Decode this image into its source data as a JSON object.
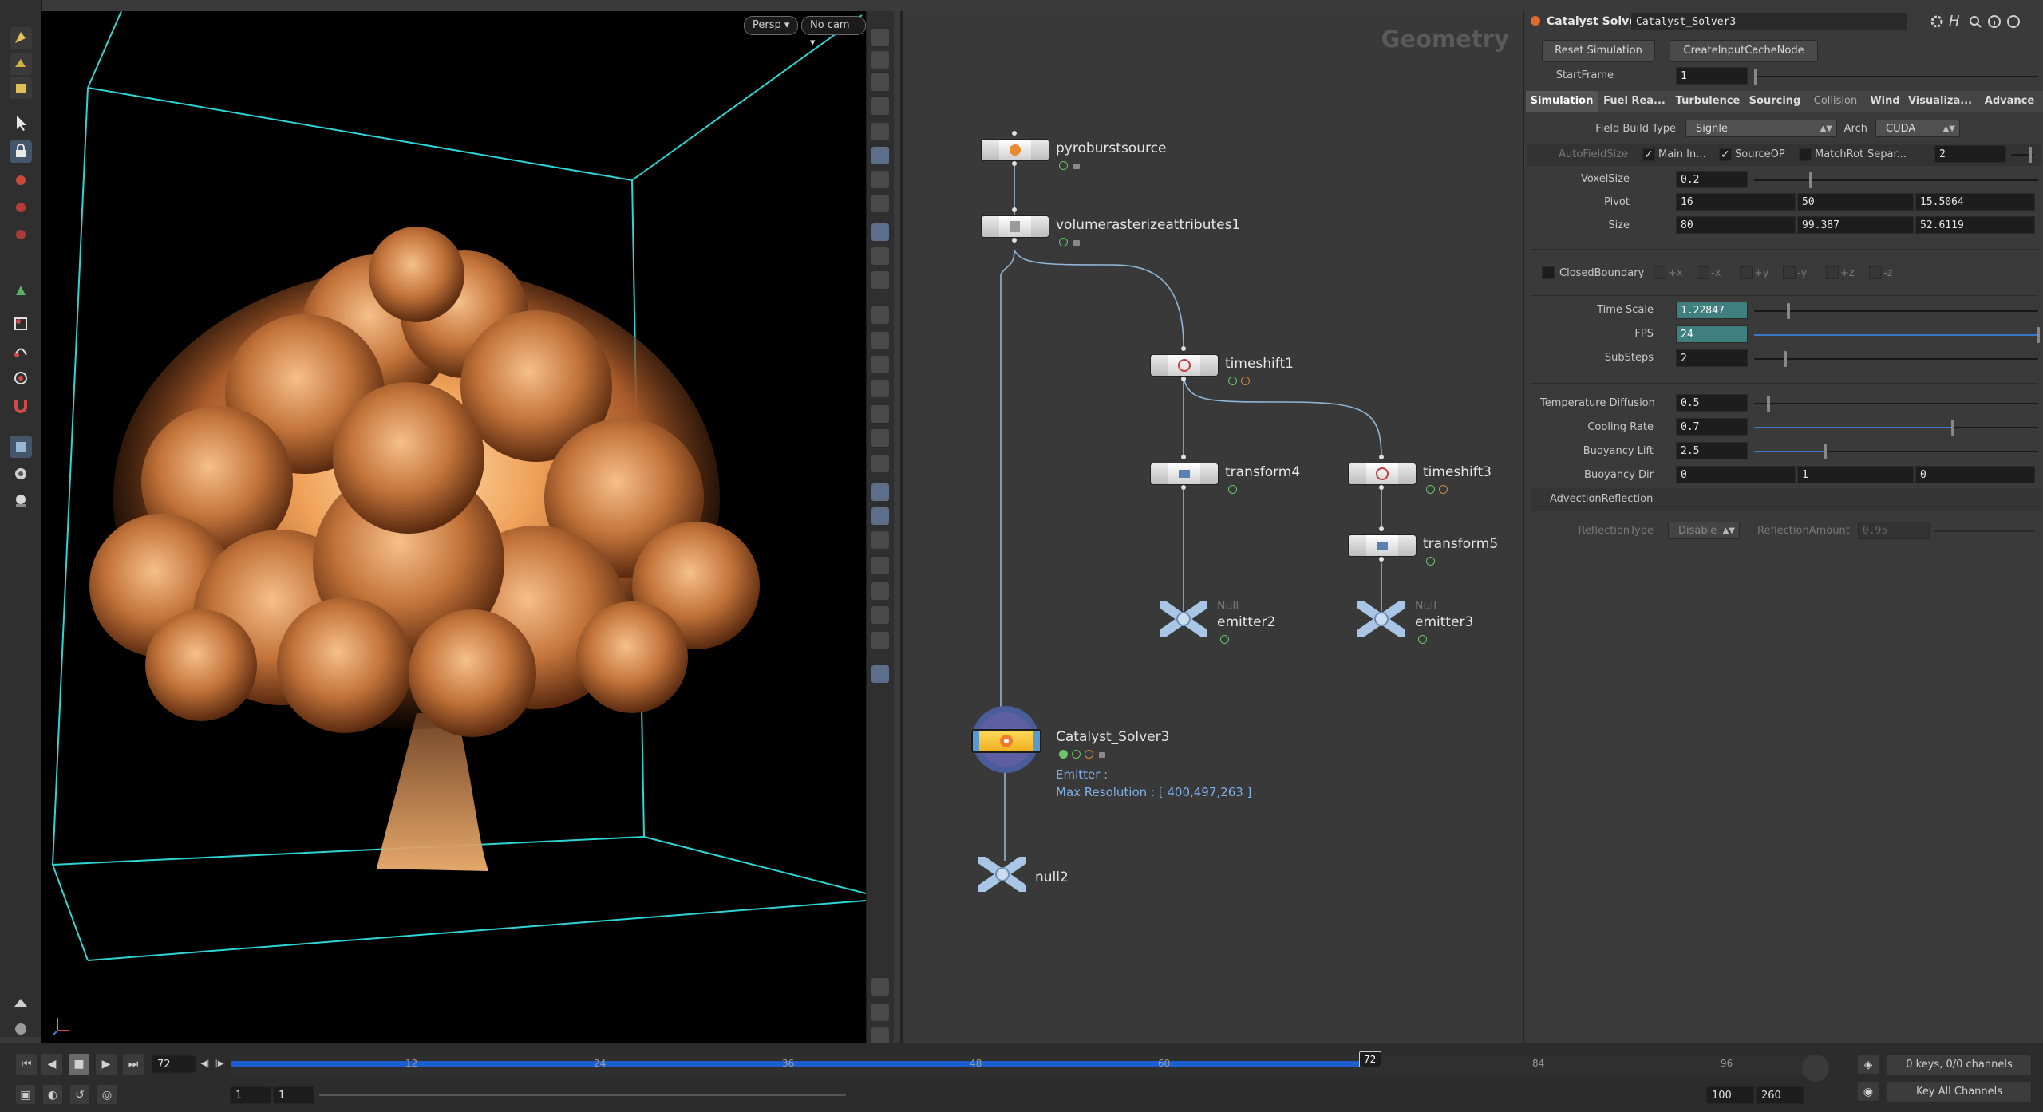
{
  "viewport": {
    "persp_label": "Persp",
    "cam_label": "No cam"
  },
  "network": {
    "context_title": "Geometry",
    "nodes": [
      {
        "name": "pyroburstsource"
      },
      {
        "name": "volumerasterizeattributes1"
      },
      {
        "name": "timeshift1"
      },
      {
        "name": "transform4"
      },
      {
        "name": "timeshift3"
      },
      {
        "name": "transform5"
      },
      {
        "name": "emitter2",
        "type": "Null"
      },
      {
        "name": "emitter3",
        "type": "Null"
      },
      {
        "name": "Catalyst_Solver3",
        "info_emitter": "Emitter :",
        "info_resolution": "Max Resolution : [ 400,497,263 ]"
      },
      {
        "name": "null2"
      }
    ]
  },
  "params": {
    "node_type": "Catalyst Solver",
    "node_name": "Catalyst_Solver3",
    "reset_button": "Reset Simulation",
    "cache_button": "CreateInputCacheNode",
    "start_frame_label": "StartFrame",
    "start_frame": "1",
    "tabs": [
      "Simulation",
      "Fuel Rea...",
      "Turbulence",
      "Sourcing",
      "Collision",
      "Wind",
      "Visualiza...",
      "Advance"
    ],
    "field_build_type_label": "Field Build Type",
    "field_build_type": "Signle",
    "arch_label": "Arch",
    "arch": "CUDA",
    "autofieldsize_label": "AutoFieldSize",
    "main_in_label": "Main In...",
    "sourceop_label": "SourceOP",
    "matchrot_label": "MatchRot",
    "separ_label": "Separ...",
    "separ_value": "2",
    "voxelsize_label": "VoxelSize",
    "voxelsize": "0.2",
    "voxelsize_fraction": 0.2,
    "pivot_label": "Pivot",
    "pivot": [
      "16",
      "50",
      "15.5064"
    ],
    "size_label": "Size",
    "size": [
      "80",
      "99.387",
      "52.6119"
    ],
    "closed_boundary_label": "ClosedBoundary",
    "boundary_axes": [
      "+x",
      "-x",
      "+y",
      "-y",
      "+z",
      "-z"
    ],
    "time_scale_label": "Time Scale",
    "time_scale": "1.22847",
    "time_scale_fraction": 0.12,
    "fps_label": "FPS",
    "fps": "24",
    "fps_fraction": 1.0,
    "substeps_label": "SubSteps",
    "substeps": "2",
    "substeps_fraction": 0.11,
    "temp_diffusion_label": "Temperature Diffusion",
    "temp_diffusion": "0.5",
    "temp_diffusion_fraction": 0.05,
    "cooling_rate_label": "Cooling Rate",
    "cooling_rate": "0.7",
    "cooling_rate_fraction": 0.7,
    "buoyancy_lift_label": "Buoyancy Lift",
    "buoyancy_lift": "2.5",
    "buoyancy_lift_fraction": 0.25,
    "buoyancy_dir_label": "Buoyancy Dir",
    "buoyancy_dir": [
      "0",
      "1",
      "0"
    ],
    "advection_reflection_label": "AdvectionReflection",
    "reflection_type_label": "ReflectionType",
    "reflection_type": "Disable",
    "reflection_amount_label": "ReflectionAmount",
    "reflection_amount": "0.95"
  },
  "timeline": {
    "current_frame": "72",
    "ticks": [
      "12",
      "24",
      "36",
      "48",
      "60",
      "84",
      "96"
    ],
    "start_frame": "1",
    "start_frame2": "1",
    "end_frame": "100",
    "end_frame2": "260",
    "keys_status": "0 keys, 0/0 channels",
    "key_all_channels": "Key All Channels",
    "frame_fraction": 0.72
  },
  "colors": {
    "accent": "#3a77c8",
    "teal_field": "#3f7f80",
    "wire": "#8fb6d8",
    "bbox": "#2fd4d4",
    "playhead": "#1e5fd0"
  }
}
